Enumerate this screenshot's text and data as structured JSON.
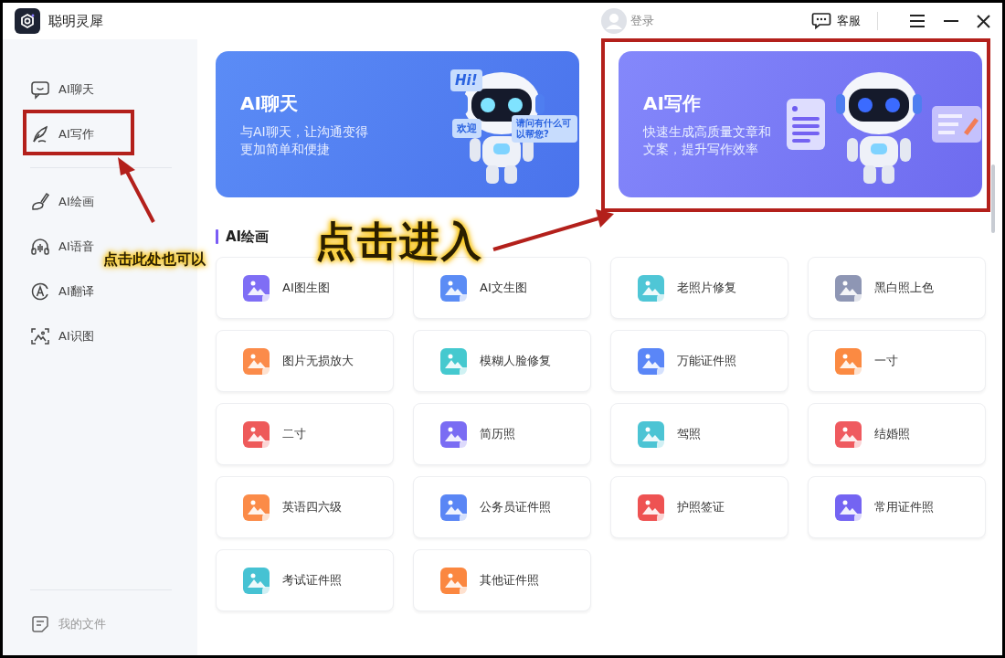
{
  "window": {
    "title": "聪明灵犀"
  },
  "header": {
    "login": "登录",
    "support": "客服"
  },
  "sidebar": {
    "items": [
      {
        "label": "AI聊天",
        "kind": "chat"
      },
      {
        "label": "AI写作",
        "kind": "write"
      },
      {
        "label": "AI绘画",
        "kind": "brush"
      },
      {
        "label": "AI语音",
        "kind": "voice"
      },
      {
        "label": "AI翻译",
        "kind": "translate"
      },
      {
        "label": "AI识图",
        "kind": "scan"
      }
    ],
    "footer": {
      "label": "我的文件"
    }
  },
  "banners": [
    {
      "kind": "chat",
      "title": "AI聊天",
      "text": "与AI聊天，让沟通变得更加简单和便捷",
      "bubbles": [
        "Hi!",
        "欢迎",
        "请问有什么可以帮您?"
      ]
    },
    {
      "kind": "write",
      "title": "AI写作",
      "text": "快速生成高质量文章和文案，提升写作效率"
    }
  ],
  "section": {
    "title": "AI绘画",
    "tools": [
      {
        "label": "AI图生图",
        "color": "#7f6ef5"
      },
      {
        "label": "AI文生图",
        "color": "#5b8cf5"
      },
      {
        "label": "老照片修复",
        "color": "#4fc6d6"
      },
      {
        "label": "黑白照上色",
        "color": "#8e96b4"
      },
      {
        "label": "图片无损放大",
        "color": "#fb8b4a"
      },
      {
        "label": "模糊人脸修复",
        "color": "#45c9cf"
      },
      {
        "label": "万能证件照",
        "color": "#5a86f7"
      },
      {
        "label": "一寸",
        "color": "#fb8a42"
      },
      {
        "label": "二寸",
        "color": "#ee5a5a"
      },
      {
        "label": "简历照",
        "color": "#7a6cf3"
      },
      {
        "label": "驾照",
        "color": "#4cc4d4"
      },
      {
        "label": "结婚照",
        "color": "#ef5a5f"
      },
      {
        "label": "英语四六级",
        "color": "#fb8b48"
      },
      {
        "label": "公务员证件照",
        "color": "#5a86f5"
      },
      {
        "label": "护照签证",
        "color": "#ee5252"
      },
      {
        "label": "常用证件照",
        "color": "#7464f2"
      },
      {
        "label": "考试证件照",
        "color": "#46c2d3"
      },
      {
        "label": "其他证件照",
        "color": "#fb8740"
      }
    ]
  },
  "annotations": {
    "callouts": [
      {
        "text": "点击此处也可以"
      },
      {
        "text": "点击进入"
      }
    ]
  }
}
